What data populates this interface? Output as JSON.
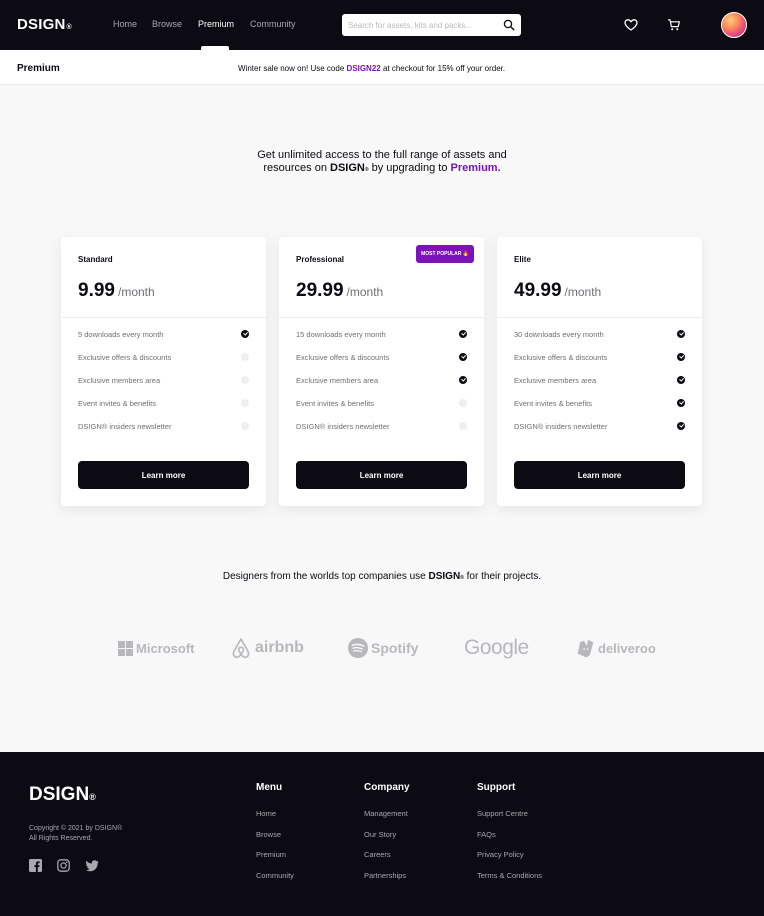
{
  "brand": {
    "name": "DSIGN",
    "reg": "®"
  },
  "nav": {
    "links": [
      "Home",
      "Browse",
      "Premium",
      "Community"
    ],
    "active": "Premium",
    "search_placeholder": "Search for assets, kits and packs..."
  },
  "subbar": {
    "title": "Premium",
    "promo_prefix": "Winter sale now on! Use code ",
    "promo_code": "DSIGN22",
    "promo_suffix": " at checkout for 15% off your order."
  },
  "hero": {
    "line1": "Get unlimited access to the full range of assets and",
    "line2_prefix": "resources on ",
    "line2_brand": "DSIGN",
    "line2_mid": " by upgrading to ",
    "line2_accent": "Premium."
  },
  "plans": [
    {
      "name": "Standard",
      "price": "9.99",
      "period": "/month",
      "badge": "",
      "features": [
        {
          "label": "5 downloads every month",
          "included": true
        },
        {
          "label": "Exclusive offers & discounts",
          "included": false
        },
        {
          "label": "Exclusive members area",
          "included": false
        },
        {
          "label": "Event invites & benefits",
          "included": false
        },
        {
          "label": "DSIGN® insiders newsletter",
          "included": false
        }
      ],
      "cta": "Learn more"
    },
    {
      "name": "Professional",
      "price": "29.99",
      "period": "/month",
      "badge": "MOST POPULAR 🔥",
      "features": [
        {
          "label": "15 downloads every month",
          "included": true
        },
        {
          "label": "Exclusive offers & discounts",
          "included": true
        },
        {
          "label": "Exclusive members area",
          "included": true
        },
        {
          "label": "Event invites & benefits",
          "included": false
        },
        {
          "label": "DSIGN® insiders newsletter",
          "included": false
        }
      ],
      "cta": "Learn more"
    },
    {
      "name": "Elite",
      "price": "49.99",
      "period": "/month",
      "badge": "",
      "features": [
        {
          "label": "30 downloads every month",
          "included": true
        },
        {
          "label": "Exclusive offers & discounts",
          "included": true
        },
        {
          "label": "Exclusive members area",
          "included": true
        },
        {
          "label": "Event invites & benefits",
          "included": true
        },
        {
          "label": "DSIGN® insiders newsletter",
          "included": true
        }
      ],
      "cta": "Learn more"
    }
  ],
  "partners": {
    "title_prefix": "Designers from the worlds top companies use ",
    "title_brand": "DSIGN",
    "title_suffix": " for their projects.",
    "logos": [
      "Microsoft",
      "airbnb",
      "Spotify",
      "Google",
      "deliveroo"
    ]
  },
  "footer": {
    "copyright_line1": "Copyright © 2021 by DSIGN®",
    "copyright_line2": "All Rights Reserved.",
    "social": [
      "facebook-icon",
      "instagram-icon",
      "twitter-icon"
    ],
    "columns": [
      {
        "title": "Menu",
        "links": [
          "Home",
          "Browse",
          "Premium",
          "Community"
        ]
      },
      {
        "title": "Company",
        "links": [
          "Management",
          "Our Story",
          "Careers",
          "Partnerships"
        ]
      },
      {
        "title": "Support",
        "links": [
          "Support Centre",
          "FAQs",
          "Privacy Policy",
          "Terms & Conditions"
        ]
      }
    ]
  },
  "colors": {
    "dark": "#0c0a12",
    "accent": "#7d12b8",
    "muted": "#6f6e74",
    "logo_gray": "#b8b8bc"
  }
}
